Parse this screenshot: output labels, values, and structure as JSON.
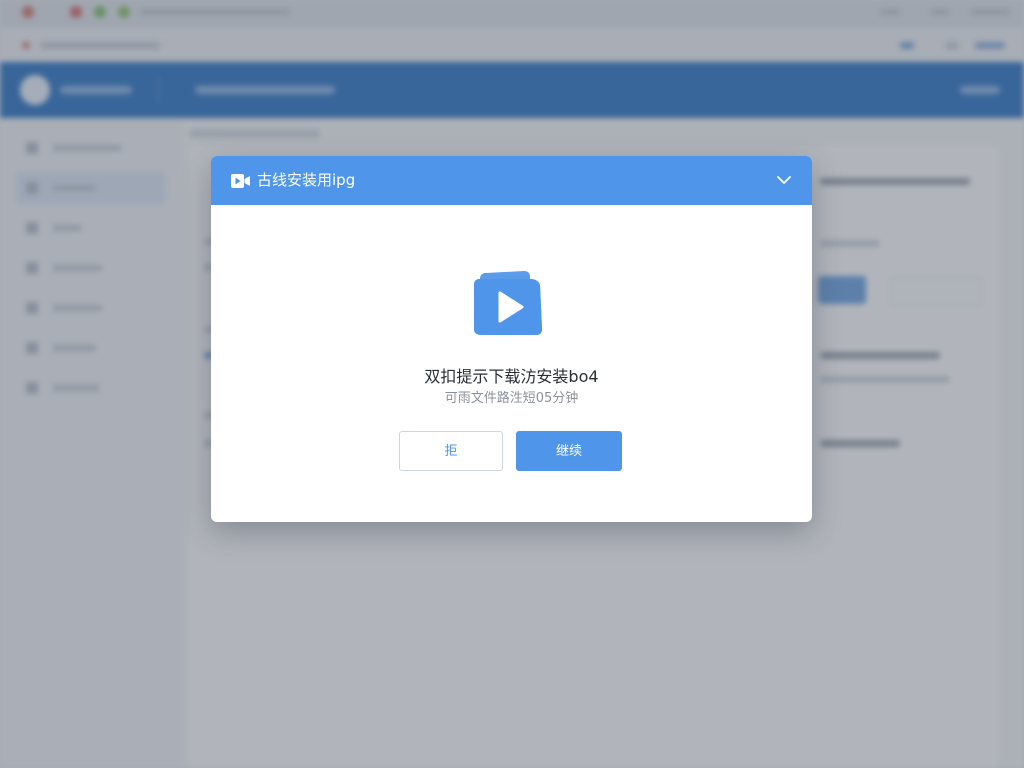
{
  "dialog": {
    "title": "古线安装用ipg",
    "header_icon": "video-icon",
    "collapse_icon": "chevron-down-icon",
    "illustration_icon": "play-icon",
    "message": "双扣提示下载汸安装bo4",
    "sub_message": "可雨文件路泩短05分钟",
    "cancel_label": "拒",
    "confirm_label": "继续"
  },
  "colors": {
    "accent": "#4f96ea",
    "app_header": "#2f75c4",
    "overlay": "rgba(72, 80, 96, 0.42)"
  }
}
